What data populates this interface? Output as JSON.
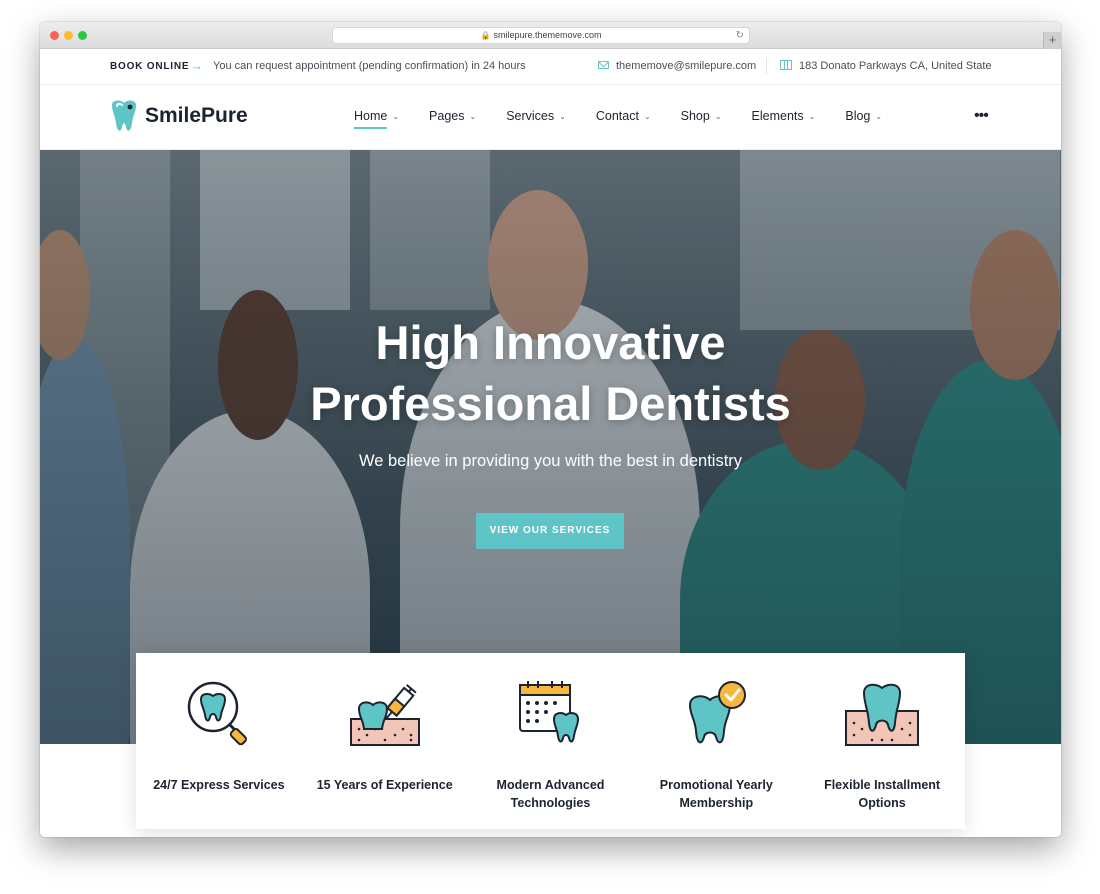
{
  "browser": {
    "url": "smilepure.thememove.com"
  },
  "topbar": {
    "book_label": "BOOK ONLINE",
    "notice": "You can request appointment (pending confirmation) in 24 hours",
    "email": "thememove@smilepure.com",
    "address": "183 Donato Parkways CA, United State"
  },
  "header": {
    "brand": "SmilePure",
    "nav": [
      {
        "label": "Home",
        "active": true
      },
      {
        "label": "Pages"
      },
      {
        "label": "Services"
      },
      {
        "label": "Contact"
      },
      {
        "label": "Shop"
      },
      {
        "label": "Elements"
      },
      {
        "label": "Blog"
      }
    ]
  },
  "hero": {
    "title_line1": "High Innovative",
    "title_line2": "Professional Dentists",
    "subtitle": "We believe in providing you with the best in dentistry",
    "button_label": "VIEW OUR SERVICES"
  },
  "features": [
    {
      "icon": "tooth-search-icon",
      "label": "24/7 Express Services"
    },
    {
      "icon": "tooth-injection-icon",
      "label": "15 Years of Experience"
    },
    {
      "icon": "calendar-tooth-icon",
      "label": "Modern Advanced Technologies"
    },
    {
      "icon": "tooth-check-icon",
      "label": "Promotional Yearly Membership"
    },
    {
      "icon": "tooth-gum-icon",
      "label": "Flexible Installment Options"
    }
  ],
  "colors": {
    "accent": "#5fc4c6",
    "dark": "#1c2331",
    "peach": "#f2c6b6",
    "orange": "#f6b73c"
  }
}
